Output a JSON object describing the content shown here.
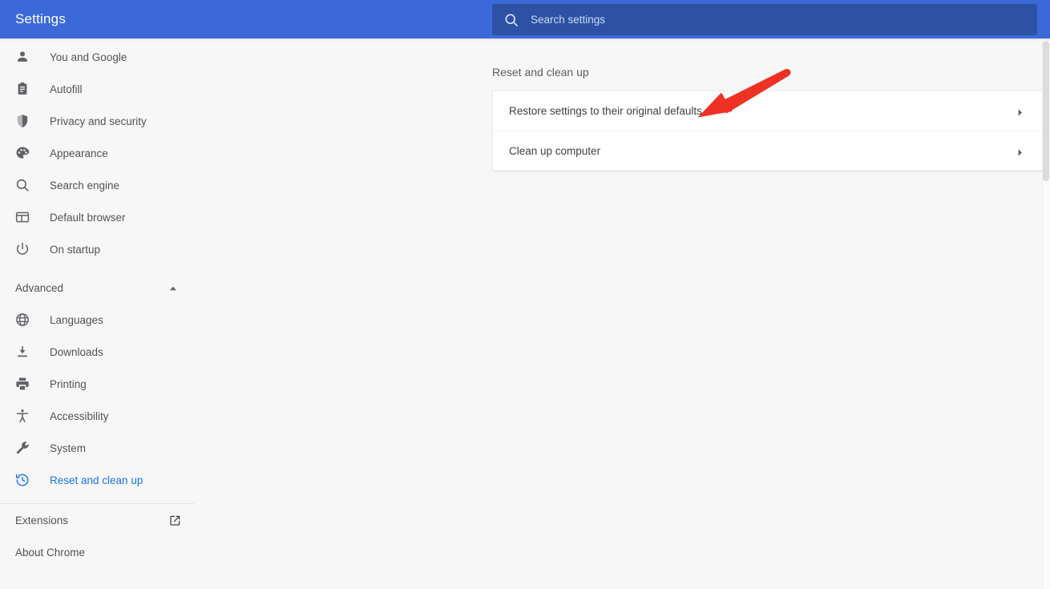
{
  "header": {
    "title": "Settings",
    "search": {
      "placeholder": "Search settings",
      "value": "",
      "icon": "search-icon"
    },
    "background_color": "#3b6ad8",
    "search_background_color": "#2d52a4"
  },
  "sidebar": {
    "items": [
      {
        "label": "You and Google",
        "icon": "person-icon",
        "active": false
      },
      {
        "label": "Autofill",
        "icon": "clipboard-icon",
        "active": false
      },
      {
        "label": "Privacy and security",
        "icon": "shield-icon",
        "active": false
      },
      {
        "label": "Appearance",
        "icon": "palette-icon",
        "active": false
      },
      {
        "label": "Search engine",
        "icon": "search-icon",
        "active": false
      },
      {
        "label": "Default browser",
        "icon": "browser-window-icon",
        "active": false
      },
      {
        "label": "On startup",
        "icon": "power-icon",
        "active": false
      }
    ],
    "advanced": {
      "label": "Advanced",
      "expanded": true,
      "chevron_icon": "chevron-up-icon",
      "items": [
        {
          "label": "Languages",
          "icon": "globe-icon",
          "active": false
        },
        {
          "label": "Downloads",
          "icon": "download-icon",
          "active": false
        },
        {
          "label": "Printing",
          "icon": "printer-icon",
          "active": false
        },
        {
          "label": "Accessibility",
          "icon": "accessibility-icon",
          "active": false
        },
        {
          "label": "System",
          "icon": "wrench-icon",
          "active": false
        },
        {
          "label": "Reset and clean up",
          "icon": "history-restore-icon",
          "active": true
        }
      ]
    },
    "bottom_items": [
      {
        "label": "Extensions",
        "trailing_icon": "external-link-icon"
      },
      {
        "label": "About Chrome",
        "trailing_icon": ""
      }
    ],
    "active_color": "#1a73e8",
    "text_color": "#4f5356"
  },
  "main": {
    "section_title": "Reset and clean up",
    "rows": [
      {
        "label": "Restore settings to their original defaults",
        "chevron_icon": "chevron-right-icon"
      },
      {
        "label": "Clean up computer",
        "chevron_icon": "chevron-right-icon"
      }
    ]
  },
  "annotation": {
    "shape": "arrow",
    "color": "#ee3124",
    "points_to": "Restore settings to their original defaults"
  }
}
